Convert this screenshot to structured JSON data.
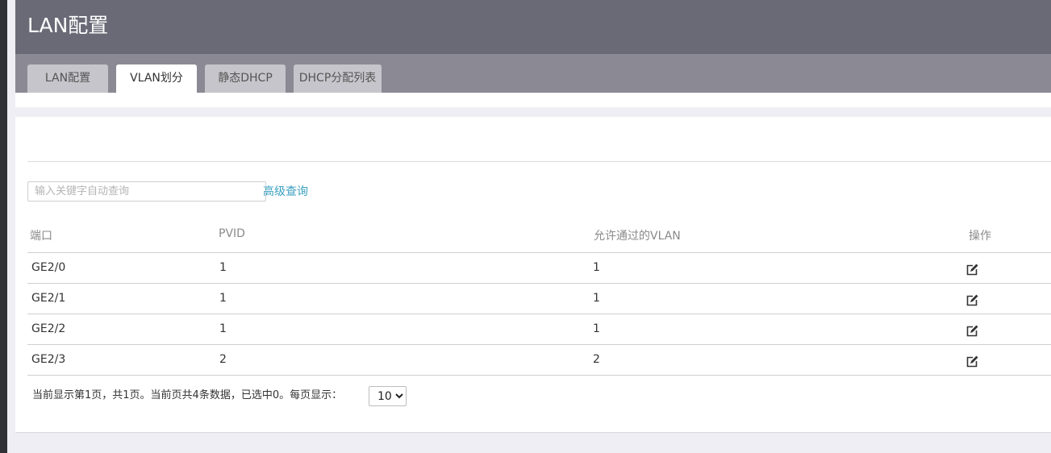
{
  "header": {
    "title": "LAN配置"
  },
  "tabs": [
    {
      "label": "LAN配置",
      "active": false
    },
    {
      "label": "VLAN划分",
      "active": true
    },
    {
      "label": "静态DHCP",
      "active": false
    },
    {
      "label": "DHCP分配列表",
      "active": false
    }
  ],
  "search": {
    "placeholder": "输入关键字自动查询",
    "value": ""
  },
  "advanced_search_label": "高级查询",
  "table": {
    "columns": [
      "端口",
      "PVID",
      "允许通过的VLAN",
      "操作"
    ],
    "rows": [
      {
        "port": "GE2/0",
        "pvid": "1",
        "allowed_vlan": "1"
      },
      {
        "port": "GE2/1",
        "pvid": "1",
        "allowed_vlan": "1"
      },
      {
        "port": "GE2/2",
        "pvid": "1",
        "allowed_vlan": "1"
      },
      {
        "port": "GE2/3",
        "pvid": "2",
        "allowed_vlan": "2"
      }
    ],
    "action_icon": "edit-icon"
  },
  "footer": {
    "status_text": "当前显示第1页，共1页。当前页共4条数据，已选中0。每页显示：",
    "page_size": "10",
    "page_size_options": [
      "10"
    ]
  },
  "colors": {
    "header_bg": "#696a76",
    "tabbar_bg": "#8b8a94",
    "tab_bg": "#c5c5cb",
    "tab_active_bg": "#ffffff",
    "link": "#3aa0c0",
    "page_bg": "#eeeef4"
  }
}
